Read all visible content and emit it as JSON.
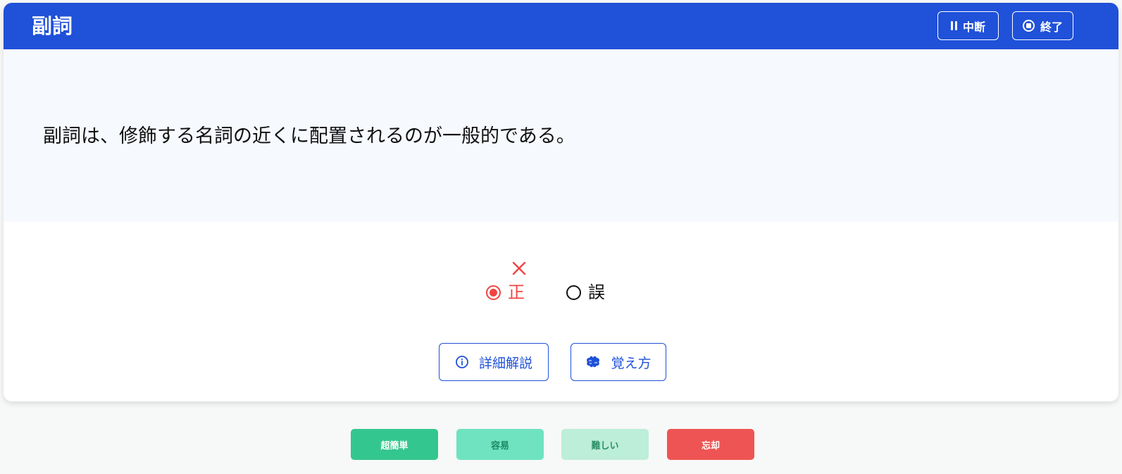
{
  "header": {
    "title": "副詞",
    "pause_label": "中断",
    "stop_label": "終了"
  },
  "question": {
    "text": "副詞は、修飾する名詞の近くに配置されるのが一般的である。"
  },
  "choices": [
    {
      "label": "正",
      "selected": true,
      "result": "incorrect"
    },
    {
      "label": "誤",
      "selected": false
    }
  ],
  "actions": {
    "detail_label": "詳細解説",
    "memo_label": "覚え方"
  },
  "ratings": [
    {
      "label": "超簡単",
      "bg": "#34c68f",
      "color": "#ffffff"
    },
    {
      "label": "容易",
      "bg": "#6fe3c0",
      "color": "#1c8a63"
    },
    {
      "label": "難しい",
      "bg": "#bdeed9",
      "color": "#2a8f66"
    },
    {
      "label": "忘却",
      "bg": "#ef5454",
      "color": "#ffffff"
    }
  ],
  "colors": {
    "primary": "#1f51d9",
    "wrong": "#ef4444",
    "question_bg": "#f6f9fe"
  },
  "icons": {
    "pause": "pause-icon",
    "stop": "stop-circle-icon",
    "wrong_mark": "cross-icon",
    "detail": "info-circle-icon",
    "memo": "brain-icon"
  }
}
